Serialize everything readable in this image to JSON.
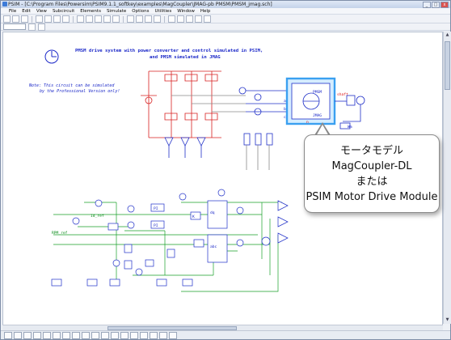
{
  "window": {
    "title": "PSIM - [C:\\Program Files\\Powersim\\PSIM9.1.1_softkey\\examples\\MagCoupler\\JMAG-pb PMSM\\PMSM_jmag.sch]",
    "min": "_",
    "max": "□",
    "close": "x"
  },
  "menu": [
    "File",
    "Edit",
    "View",
    "Subcircuit",
    "Elements",
    "Simulate",
    "Options",
    "Utilities",
    "Window",
    "Help"
  ],
  "canvas": {
    "title_line1": "PMSM drive system with power converter and control simulated in PSIM,",
    "title_line2": "and PMSM simulated in JMAG",
    "note_line1": "Note: This circuit can be simulated",
    "note_line2": "by the Professional Version only!",
    "motor_label_top": "PMSM",
    "motor_label_bottom": "JMAG",
    "shaft_label": "shaft",
    "phase_a": "a",
    "phase_b": "b",
    "phase_c": "c",
    "n_label": "n",
    "id_ref": "Id_ref",
    "rpm_ref": "RPM_ref",
    "pi_label": "PI",
    "k_label": "K",
    "wm_label": "Wm",
    "dq_label": "dq",
    "abc_label": "abc",
    "t_label": "T"
  },
  "callout": {
    "line1": "モータモデル",
    "line2": "MagCoupler-DL",
    "line3": "または",
    "line4": "PSIM Motor Drive Module"
  },
  "colors": {
    "highlight": "#3ba0f0",
    "wire_red": "#d82020",
    "wire_blue": "#2030c8",
    "wire_green": "#19a02a",
    "wire_gray": "#8a8a8a"
  }
}
